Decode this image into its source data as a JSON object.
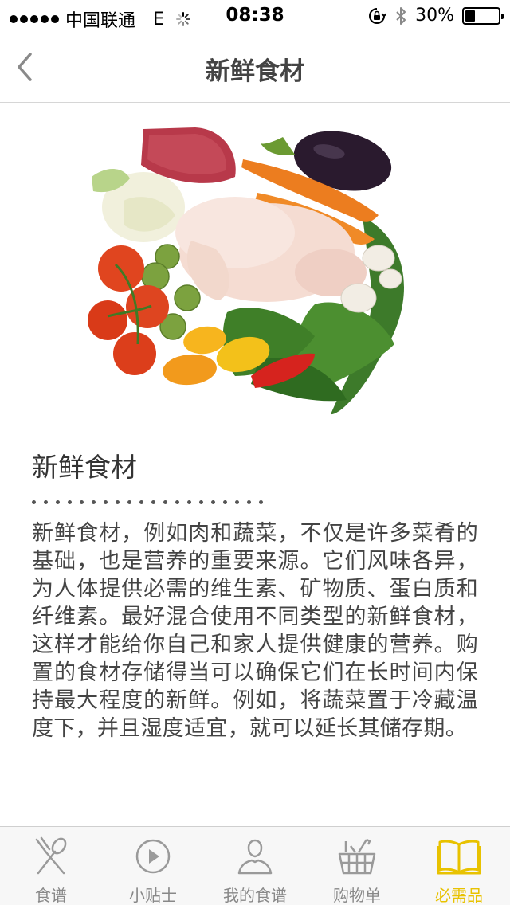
{
  "status_bar": {
    "carrier": "中国联通",
    "network": "E",
    "time": "08:38",
    "battery": "30%",
    "battery_level": 0.3
  },
  "nav": {
    "title": "新鲜食材",
    "back_icon": "chevron-left-icon"
  },
  "article": {
    "title": "新鲜食材",
    "body": "新鲜食材，例如肉和蔬菜，不仅是许多菜肴的基础，也是营养的重要来源。它们风味各异，为人体提供必需的维生素、矿物质、蛋白质和纤维素。最好混合使用不同类型的新鲜食材，这样才能给你自己和家人提供健康的营养。购置的食材存储得当可以确保它们在长时间内保持最大程度的新鲜。例如，将蔬菜置于冷藏温度下，并且湿度适宜，就可以延长其储存期。"
  },
  "tabs": [
    {
      "label": "食谱",
      "icon": "fork-spoon-icon",
      "active": false
    },
    {
      "label": "小贴士",
      "icon": "play-icon",
      "active": false
    },
    {
      "label": "我的食谱",
      "icon": "user-icon",
      "active": false
    },
    {
      "label": "购物单",
      "icon": "basket-icon",
      "active": false
    },
    {
      "label": "必需品",
      "icon": "book-icon",
      "active": true
    }
  ],
  "colors": {
    "accent": "#e8c200",
    "tab_inactive": "#888888"
  }
}
